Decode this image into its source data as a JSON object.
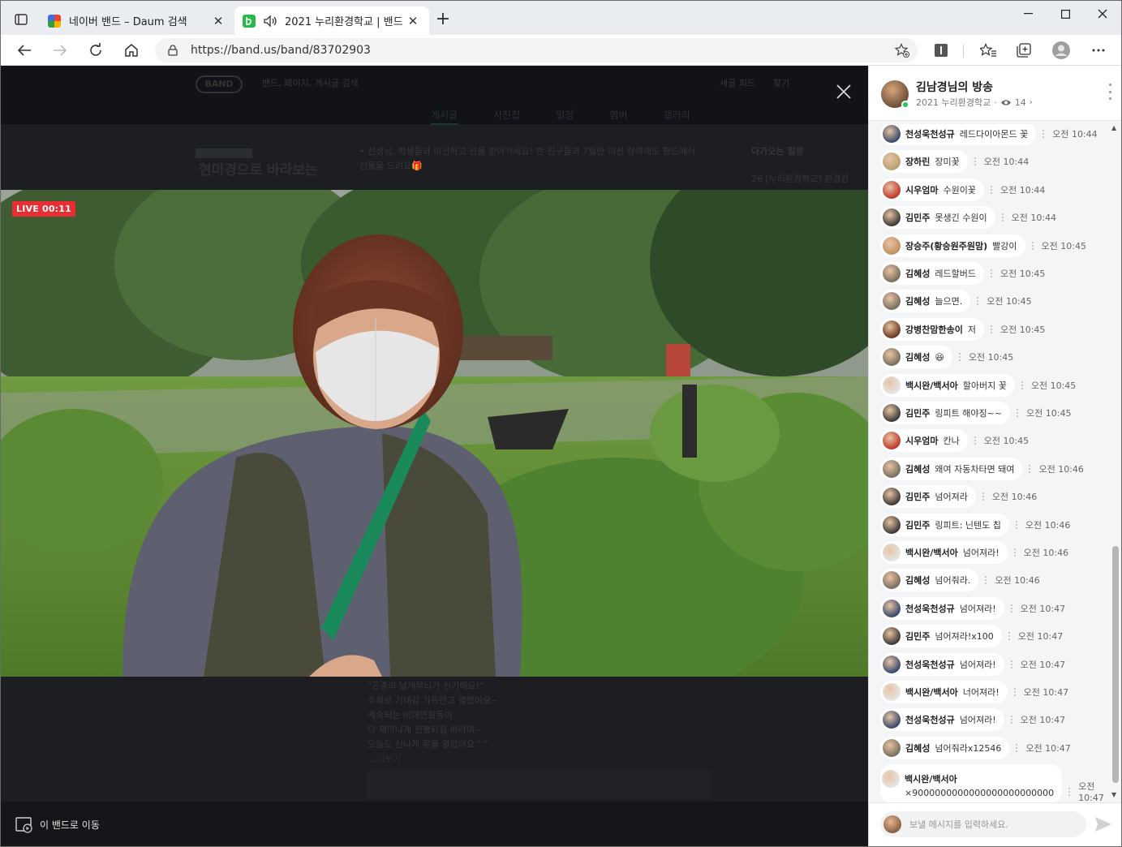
{
  "browser": {
    "tabs": [
      {
        "title": "네이버 밴드 – Daum 검색",
        "active": false,
        "favicon_color": "#3c6fe0"
      },
      {
        "title": "2021 누리환경학교 | 밴드",
        "active": true,
        "favicon_color": "#2bb84a"
      }
    ],
    "url": "https://band.us/band/83702903",
    "icons": {
      "tab_actions": "tab-actions-icon",
      "audio": "speaker-icon",
      "back": "back-arrow-icon",
      "forward": "forward-arrow-icon",
      "reload": "reload-icon",
      "home": "home-icon",
      "lock": "lock-icon",
      "add_favorite": "star-plus-icon",
      "extension": "extension-icon",
      "favorites": "favorites-icon",
      "collections": "collections-icon",
      "profile": "profile-icon",
      "more": "more-icon"
    }
  },
  "page": {
    "live_badge": "LIVE 00:11",
    "move_to_band": "이 밴드로 이동",
    "background": {
      "logo": "BAND",
      "search_hint": "밴드, 페이지, 게시글 검색",
      "top_links": [
        "새글 피드",
        "찾기"
      ],
      "nav_tabs": [
        "게시글",
        "사진첩",
        "일정",
        "멤버",
        "갤러리"
      ],
      "notice": "• 선생님, 학생들과 미션하고 선물 받아가세요! 반 친구들과 7일만 미션 참여해도 핸드에서 선물을 드려요🎁",
      "upcoming": "다가오는 일정",
      "upcoming_item": "26  [누리환경학교] 환경강",
      "post_lines": [
        "\"곤충의 날개무늬가 신기해요!\"",
        "주제로 기대감 가득안고 열렸어요~",
        "계속되는 비대면활동이",
        "더 재미나게 진행되길 바라며~",
        "오늘도 신나게 문을 열었어요^^",
        "…더보기"
      ],
      "banner": "현미경으로 바라보는"
    }
  },
  "chat": {
    "host_name": "김남경님의 방송",
    "band_name": "2021 누리환경학교",
    "viewer_count": "14",
    "input_placeholder": "보낼 메시지를 입력하세요.",
    "messages": [
      {
        "name": "천성욱천성규",
        "text": "레드다이아몬드 꽃",
        "time": "오전 10:44",
        "avatar": "#3a4a6b"
      },
      {
        "name": "장하린",
        "text": "장미꽃",
        "time": "오전 10:44",
        "avatar": "#b8a070"
      },
      {
        "name": "시우엄마",
        "text": "수원이꽃",
        "time": "오전 10:44",
        "avatar": "#c0392b"
      },
      {
        "name": "김민주",
        "text": "못생긴 수원이",
        "time": "오전 10:44",
        "avatar": "#3d3a36"
      },
      {
        "name": "장승주(황승원주원맘)",
        "text": "빨강이",
        "time": "오전 10:45",
        "avatar": "#c09060"
      },
      {
        "name": "김혜성",
        "text": "레드할버드",
        "time": "오전 10:45",
        "avatar": "#7a6e60"
      },
      {
        "name": "김혜성",
        "text": "늘으면.",
        "time": "오전 10:45",
        "avatar": "#7a6e60"
      },
      {
        "name": "강병찬맘한송이",
        "text": "저",
        "time": "오전 10:45",
        "avatar": "#6b3a22"
      },
      {
        "name": "김혜성",
        "text": "😆",
        "time": "오전 10:45",
        "avatar": "#7a6e60"
      },
      {
        "name": "백시완/백서아",
        "text": "할아버지 꽃",
        "time": "오전 10:45",
        "avatar": "#e4e4e4"
      },
      {
        "name": "김민주",
        "text": "링피트 해야징~~",
        "time": "오전 10:45",
        "avatar": "#3d3a36"
      },
      {
        "name": "시우엄마",
        "text": "칸나",
        "time": "오전 10:45",
        "avatar": "#c0392b"
      },
      {
        "name": "김혜성",
        "text": "왜여 자동차타면 돼여",
        "time": "오전 10:46",
        "avatar": "#7a6e60"
      },
      {
        "name": "김민주",
        "text": "넘어져라",
        "time": "오전 10:46",
        "avatar": "#3d3a36"
      },
      {
        "name": "김민주",
        "text": "링피트: 닌텐도 칩",
        "time": "오전 10:46",
        "avatar": "#3d3a36"
      },
      {
        "name": "백시완/백서아",
        "text": "넘어져라!",
        "time": "오전 10:46",
        "avatar": "#e4e4e4"
      },
      {
        "name": "김혜성",
        "text": "넘어줘라.",
        "time": "오전 10:46",
        "avatar": "#7a6e60"
      },
      {
        "name": "천성욱천성규",
        "text": "넘어져라!",
        "time": "오전 10:47",
        "avatar": "#3a4a6b"
      },
      {
        "name": "김민주",
        "text": "넘어져라!x100",
        "time": "오전 10:47",
        "avatar": "#3d3a36"
      },
      {
        "name": "천성욱천성규",
        "text": "넘어져라!",
        "time": "오전 10:47",
        "avatar": "#3a4a6b"
      },
      {
        "name": "백시완/백서아",
        "text": "너어져라!",
        "time": "오전 10:47",
        "avatar": "#e4e4e4"
      },
      {
        "name": "천성욱천성규",
        "text": "넘어져라!",
        "time": "오전 10:47",
        "avatar": "#3a4a6b"
      },
      {
        "name": "김혜성",
        "text": "넘어줘라x12546",
        "time": "오전 10:47",
        "avatar": "#7a6e60"
      },
      {
        "name": "백시완/백서아",
        "text": "×9000000000000000000000000",
        "time": "오전 10:47",
        "avatar": "#e4e4e4"
      }
    ]
  },
  "colors": {
    "live_red": "#ea2c33",
    "band_green": "#2bb84a",
    "page_bg": "#1c1e22",
    "chat_bg": "#f4f5f7"
  }
}
